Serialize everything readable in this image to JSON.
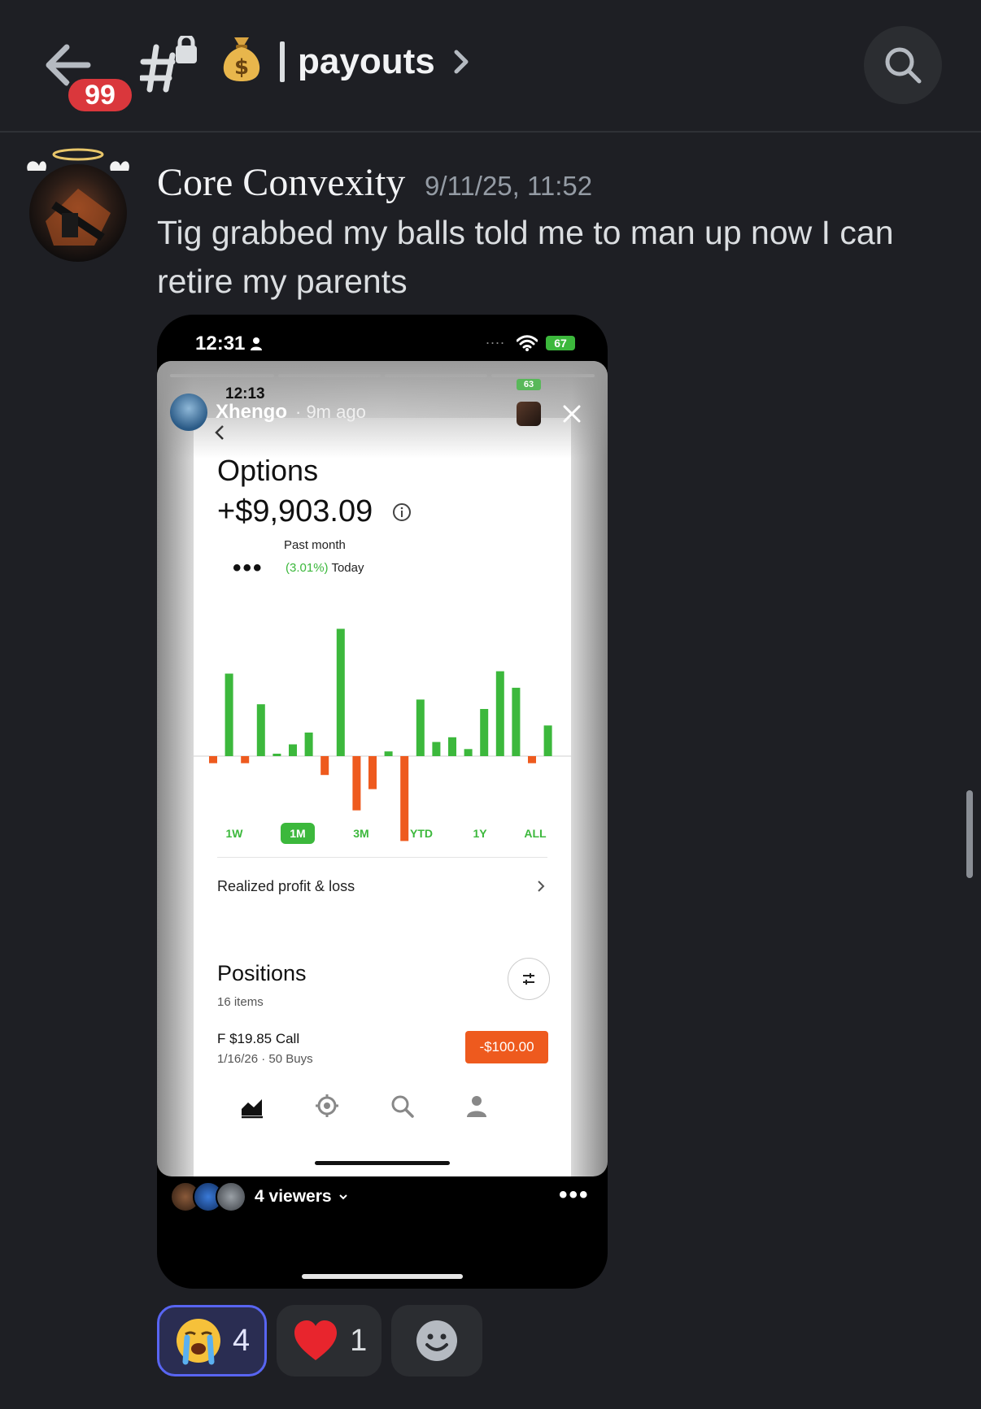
{
  "header": {
    "unread_badge": "99",
    "channel_emoji": "💰",
    "channel_name": "payouts"
  },
  "message": {
    "author": "Core Convexity",
    "timestamp": "9/11/25, 11:52",
    "text": "Tig grabbed my balls told me to man up now I can retire my parents"
  },
  "phone": {
    "status_time": "12:31",
    "battery": "67",
    "story": {
      "inner_time": "12:13",
      "inner_battery": "63",
      "author": "Xhengo",
      "posted": "· 9m ago",
      "viewers_label": "4 viewers",
      "app": {
        "title": "Options",
        "amount": "+$9,903.09",
        "period": "Past month",
        "percent": "(3.01%)",
        "today": "Today",
        "ranges": [
          "1W",
          "1M",
          "3M",
          "YTD",
          "1Y",
          "ALL"
        ],
        "active_range": "1M",
        "realized": "Realized profit & loss",
        "positions_title": "Positions",
        "positions_count": "16 items",
        "position": {
          "name": "F $19.85 Call",
          "meta": "1/16/26 · 50 Buys",
          "value": "-$100.00"
        }
      }
    }
  },
  "chart_data": {
    "type": "bar",
    "title": "",
    "xlabel": "",
    "ylabel": "",
    "values": [
      -0.3,
      3.5,
      -0.3,
      2.2,
      0.1,
      0.5,
      1.0,
      -0.8,
      5.4,
      -2.3,
      -1.4,
      0.2,
      -3.6,
      2.4,
      0.6,
      0.8,
      0.3,
      2.0,
      3.6,
      2.9,
      -0.3,
      1.3
    ],
    "colors": {
      "gain": "#3cb83c",
      "loss": "#ee5a1e"
    }
  },
  "reactions": [
    {
      "emoji": "😭",
      "count": "4",
      "name": "sob"
    },
    {
      "emoji": "❤️",
      "count": "1",
      "name": "heart"
    }
  ]
}
